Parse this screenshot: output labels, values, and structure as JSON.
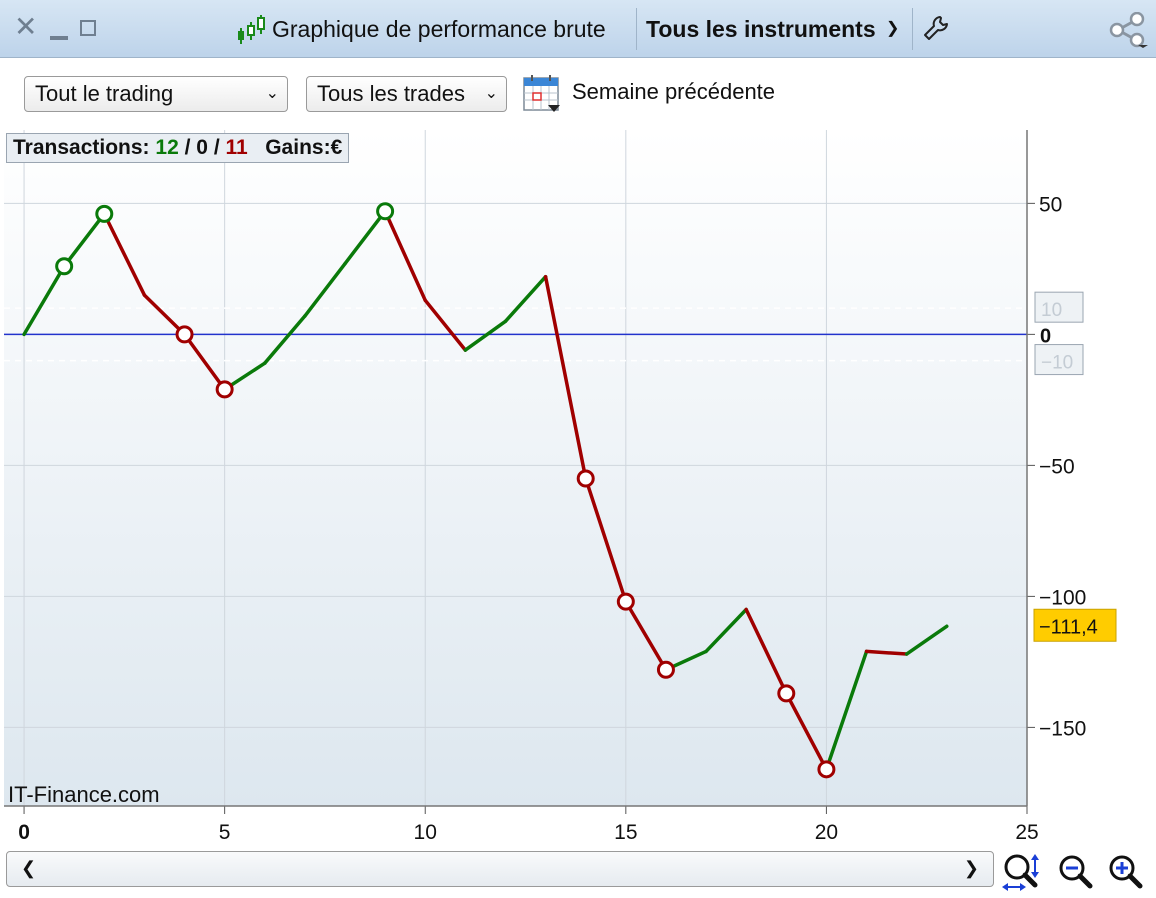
{
  "window": {
    "title": "Graphique de performance brute",
    "instrument_selector": "Tous les instruments"
  },
  "toolbar": {
    "scope_select": "Tout le trading",
    "trades_select": "Tous les trades",
    "period_label": "Semaine précédente"
  },
  "stats": {
    "transactions_label": "Transactions:",
    "wins": "12",
    "neutral": "0",
    "losses": "11",
    "separator": "/",
    "gains_label": "Gains:",
    "currency": "€"
  },
  "watermark": "IT-Finance.com",
  "colors": {
    "gain": "#0a7a0a",
    "loss": "#a00000",
    "zero_line": "#2233cc",
    "last_value_bg": "#ffcc00",
    "plot_bg_top": "#ffffff",
    "plot_bg_bottom": "#dde7ef"
  },
  "chart_data": {
    "type": "line",
    "x": [
      0,
      1,
      2,
      3,
      4,
      5,
      6,
      7,
      8,
      9,
      10,
      11,
      12,
      13,
      14,
      15,
      16,
      17,
      18,
      19,
      20,
      21,
      22,
      23
    ],
    "y": [
      0,
      26,
      46,
      15,
      0,
      -21,
      -11,
      7,
      27,
      47,
      13,
      -6,
      5,
      22,
      -55,
      -102,
      -128,
      -121,
      -105,
      -137,
      -166,
      -121,
      -122,
      -111.4
    ],
    "trade_result": [
      "",
      "gain",
      "gain",
      "loss",
      "loss",
      "loss",
      "gain",
      "gain",
      "gain",
      "gain",
      "loss",
      "loss",
      "gain",
      "gain",
      "loss",
      "loss",
      "loss",
      "gain",
      "gain",
      "loss",
      "loss",
      "gain",
      "loss",
      "gain"
    ],
    "circle_markers_at_x": [
      1,
      2,
      4,
      5,
      9,
      14,
      15,
      16,
      19,
      20
    ],
    "x_ticks": [
      0,
      5,
      10,
      15,
      20,
      25
    ],
    "y_ticks": [
      50,
      0,
      -50,
      -100,
      -150
    ],
    "xlim": [
      -0.5,
      25
    ],
    "ylim": [
      -180,
      78
    ],
    "reference_lines": [
      {
        "value": 0,
        "label": "0",
        "style": "solid"
      },
      {
        "value": 10,
        "label": "10",
        "style": "dashed"
      },
      {
        "value": -10,
        "label": "-10",
        "style": "dashed"
      }
    ],
    "last_value_label": "-111,4",
    "grid": true
  },
  "icons": {
    "close": "close-icon",
    "minimize": "minimize-icon",
    "maximize": "maximize-icon",
    "chart": "candlestick-icon",
    "settings": "wrench-icon",
    "share": "share-icon",
    "calendar": "calendar-icon",
    "scroll_left": "chevron-left-icon",
    "scroll_right": "chevron-right-icon",
    "zoom_fit": "zoom-fit-icon",
    "zoom_out": "zoom-out-icon",
    "zoom_in": "zoom-in-icon"
  }
}
